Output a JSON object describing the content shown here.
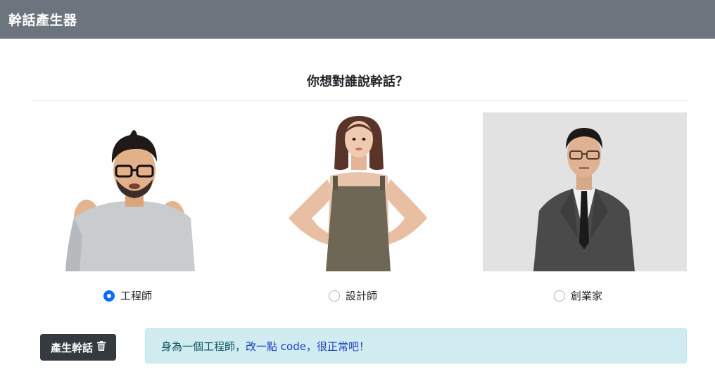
{
  "navbar": {
    "brand": "幹話產生器"
  },
  "question": "你想對誰說幹話？",
  "options": [
    {
      "label": "工程師",
      "selected": true
    },
    {
      "label": "設計師",
      "selected": false
    },
    {
      "label": "創業家",
      "selected": false
    }
  ],
  "generate_button": {
    "label": "產生幹話",
    "icon": "trash-icon"
  },
  "result": {
    "part_a": "身為一個工程師，",
    "part_b": "改一點 code，很正常吧！"
  },
  "colors": {
    "navbar_bg": "#6c757d",
    "radio_selected": "#0d6efd",
    "button_bg": "#343a40",
    "alert_bg": "#d1ecf1",
    "alert_text": "#0c5460"
  }
}
